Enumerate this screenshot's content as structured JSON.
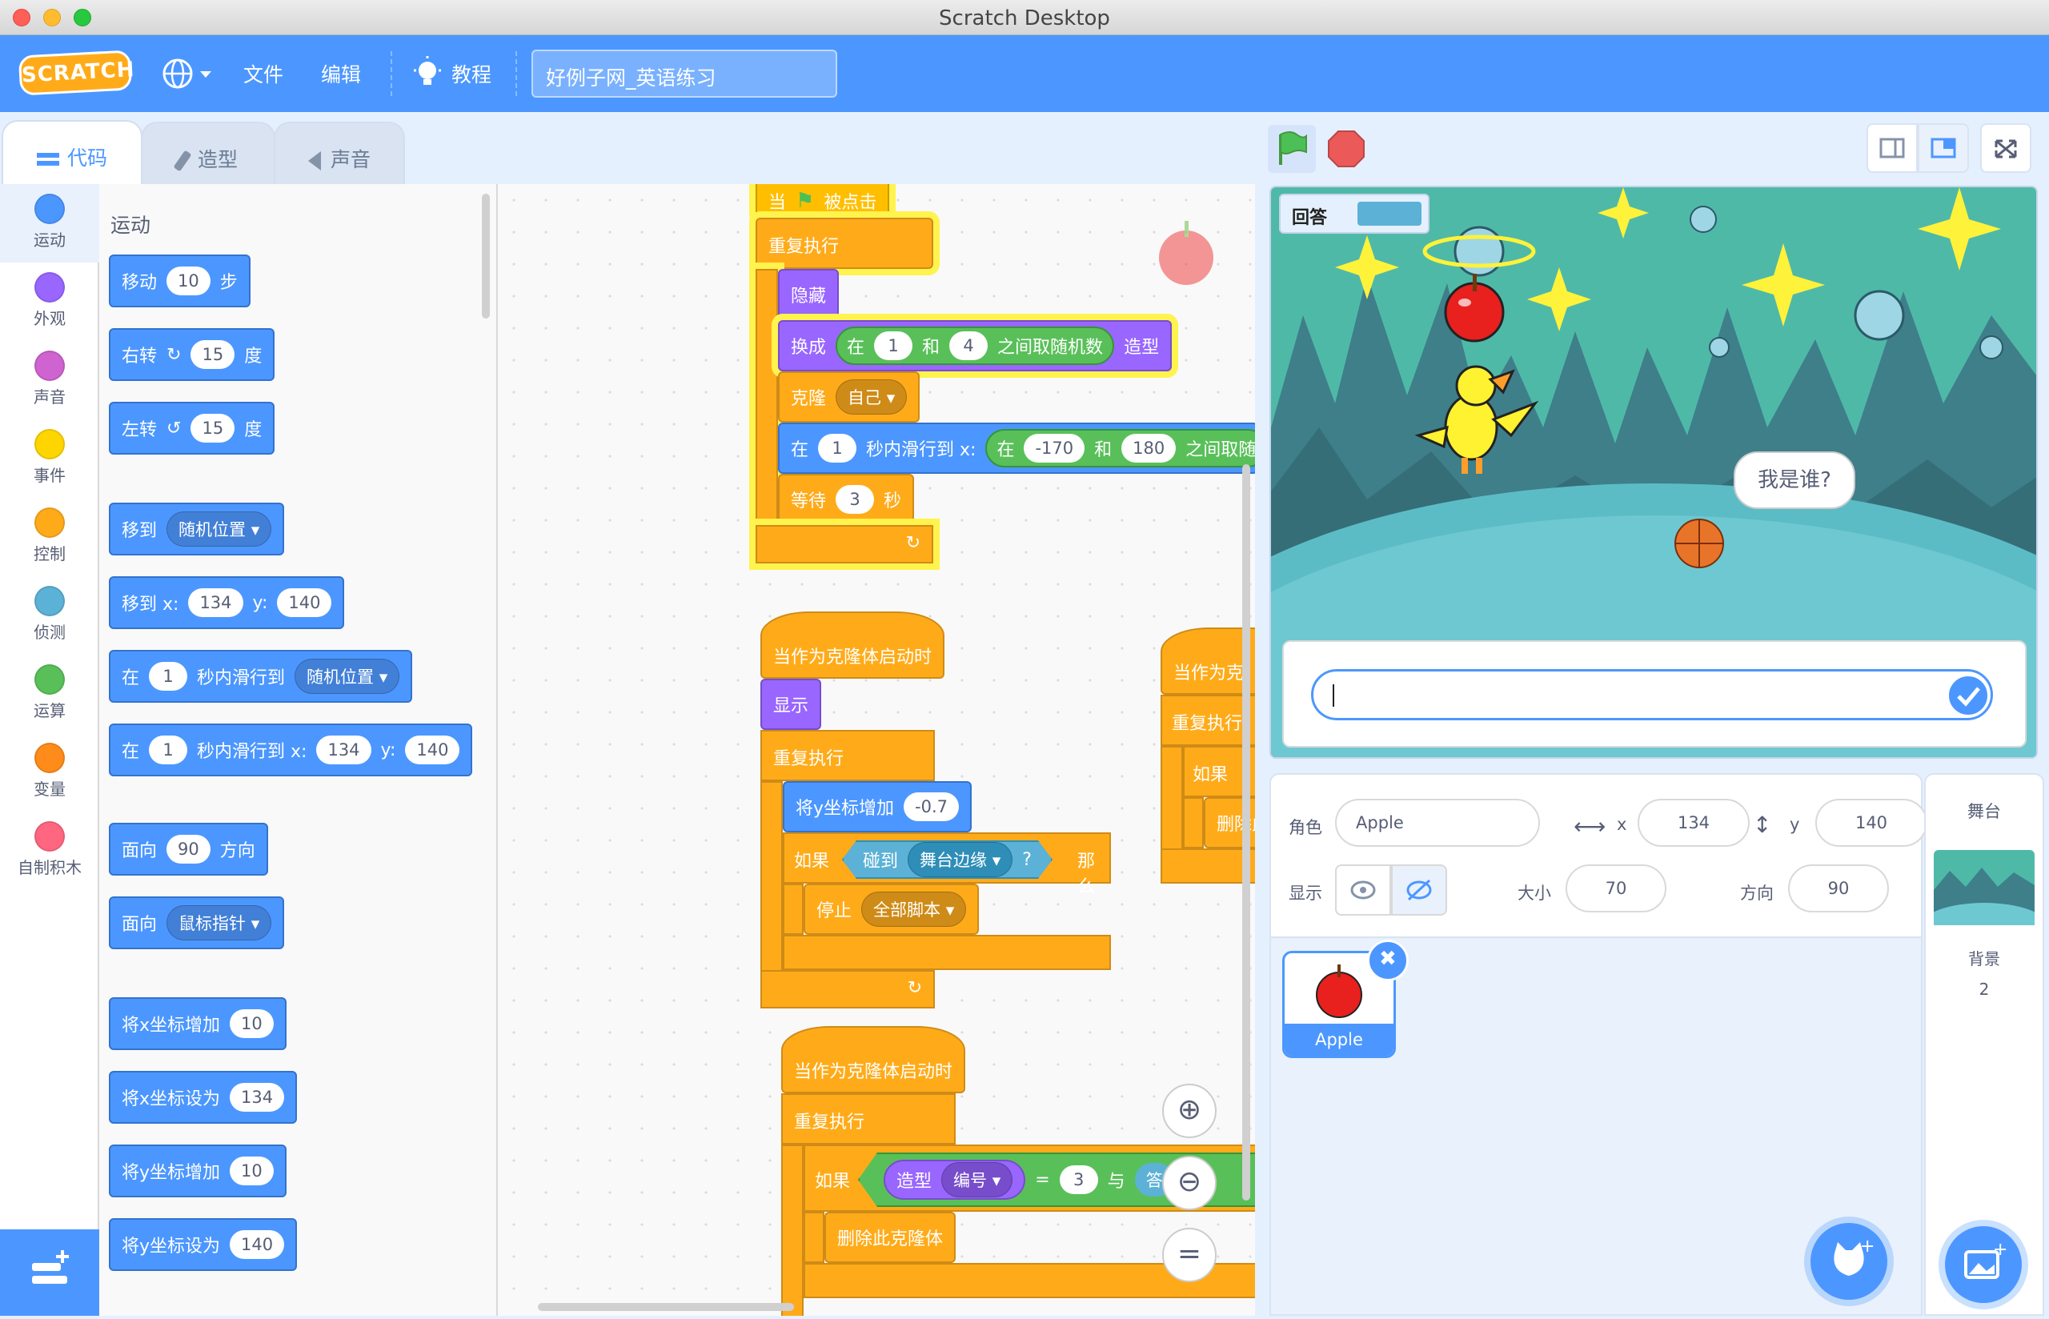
{
  "window": {
    "title": "Scratch Desktop"
  },
  "menubar": {
    "logo": "SCRATCH",
    "file": "文件",
    "edit": "编辑",
    "tutorials": "教程",
    "project_title": "好例子网_英语练习"
  },
  "tabs": {
    "code": "代码",
    "costumes": "造型",
    "sounds": "声音"
  },
  "categories": [
    {
      "label": "运动",
      "color": "#4c97ff"
    },
    {
      "label": "外观",
      "color": "#9966ff"
    },
    {
      "label": "声音",
      "color": "#cf63cf"
    },
    {
      "label": "事件",
      "color": "#ffd500"
    },
    {
      "label": "控制",
      "color": "#ffab19"
    },
    {
      "label": "侦测",
      "color": "#5cb1d6"
    },
    {
      "label": "运算",
      "color": "#59c059"
    },
    {
      "label": "变量",
      "color": "#ff8c1a"
    },
    {
      "label": "自制积木",
      "color": "#ff6680"
    }
  ],
  "palette": {
    "heading": "运动",
    "move": {
      "a": "移动",
      "v": "10",
      "b": "步"
    },
    "turn_right": {
      "a": "右转",
      "v": "15",
      "b": "度"
    },
    "turn_left": {
      "a": "左转",
      "v": "15",
      "b": "度"
    },
    "goto": {
      "a": "移到",
      "dd": "随机位置"
    },
    "goto_xy": {
      "a": "移到 x:",
      "x": "134",
      "b": "y:",
      "y": "140"
    },
    "glide": {
      "a": "在",
      "v": "1",
      "b": "秒内滑行到",
      "dd": "随机位置"
    },
    "glide_xy": {
      "a": "在",
      "v": "1",
      "b": "秒内滑行到 x:",
      "x": "134",
      "c": "y:",
      "y": "140"
    },
    "point_dir": {
      "a": "面向",
      "v": "90",
      "b": "方向"
    },
    "point_to": {
      "a": "面向",
      "dd": "鼠标指针"
    },
    "change_x": {
      "a": "将x坐标增加",
      "v": "10"
    },
    "set_x": {
      "a": "将x坐标设为",
      "v": "134"
    },
    "change_y": {
      "a": "将y坐标增加",
      "v": "10"
    },
    "set_y": {
      "a": "将y坐标设为",
      "v": "140"
    }
  },
  "script1": {
    "hat": {
      "a": "当",
      "b": "被点击"
    },
    "forever": "重复执行",
    "hide": "隐藏",
    "switch": {
      "a": "换成",
      "b": "在",
      "v1": "1",
      "c": "和",
      "v2": "4",
      "d": "之间取随机数",
      "e": "造型"
    },
    "clone": {
      "a": "克隆",
      "dd": "自己"
    },
    "glide": {
      "a": "在",
      "v": "1",
      "b": "秒内滑行到 x:",
      "c": "在",
      "v1": "-170",
      "d": "和",
      "v2": "180",
      "e": "之间取随"
    },
    "wait": {
      "a": "等待",
      "v": "3",
      "b": "秒"
    }
  },
  "script2": {
    "hat": "当作为克隆体启动时",
    "show": "显示",
    "forever": "重复执行",
    "change_y": {
      "a": "将y坐标增加",
      "v": "-0.7"
    },
    "if": {
      "a": "如果",
      "b": "碰到",
      "dd": "舞台边缘",
      "q": "?",
      "c": "那么"
    },
    "stop": {
      "a": "停止",
      "dd": "全部脚本"
    }
  },
  "script3": {
    "hat": "当作为克隆体启动时",
    "forever": "重复执行",
    "if": {
      "a": "如果",
      "b": "造型",
      "dd": "编号",
      "eq": "=",
      "v": "3",
      "c": "与",
      "d": "答"
    },
    "delete": "删除此克隆体"
  },
  "script4": {
    "hat": "当作为克",
    "forever": "重复执行",
    "if": "如果",
    "delete": "删除此"
  },
  "stage": {
    "answer_label": "回答",
    "speech": "我是谁?"
  },
  "sprite": {
    "sprite_label": "角色",
    "name": "Apple",
    "x_label": "x",
    "x": "134",
    "y_label": "y",
    "y": "140",
    "show_label": "显示",
    "size_label": "大小",
    "size": "70",
    "direction_label": "方向",
    "direction": "90"
  },
  "sprite_list": [
    {
      "name": "Apple"
    }
  ],
  "stage_pane": {
    "title": "舞台",
    "backdrops_label": "背景",
    "backdrops_count": "2"
  }
}
